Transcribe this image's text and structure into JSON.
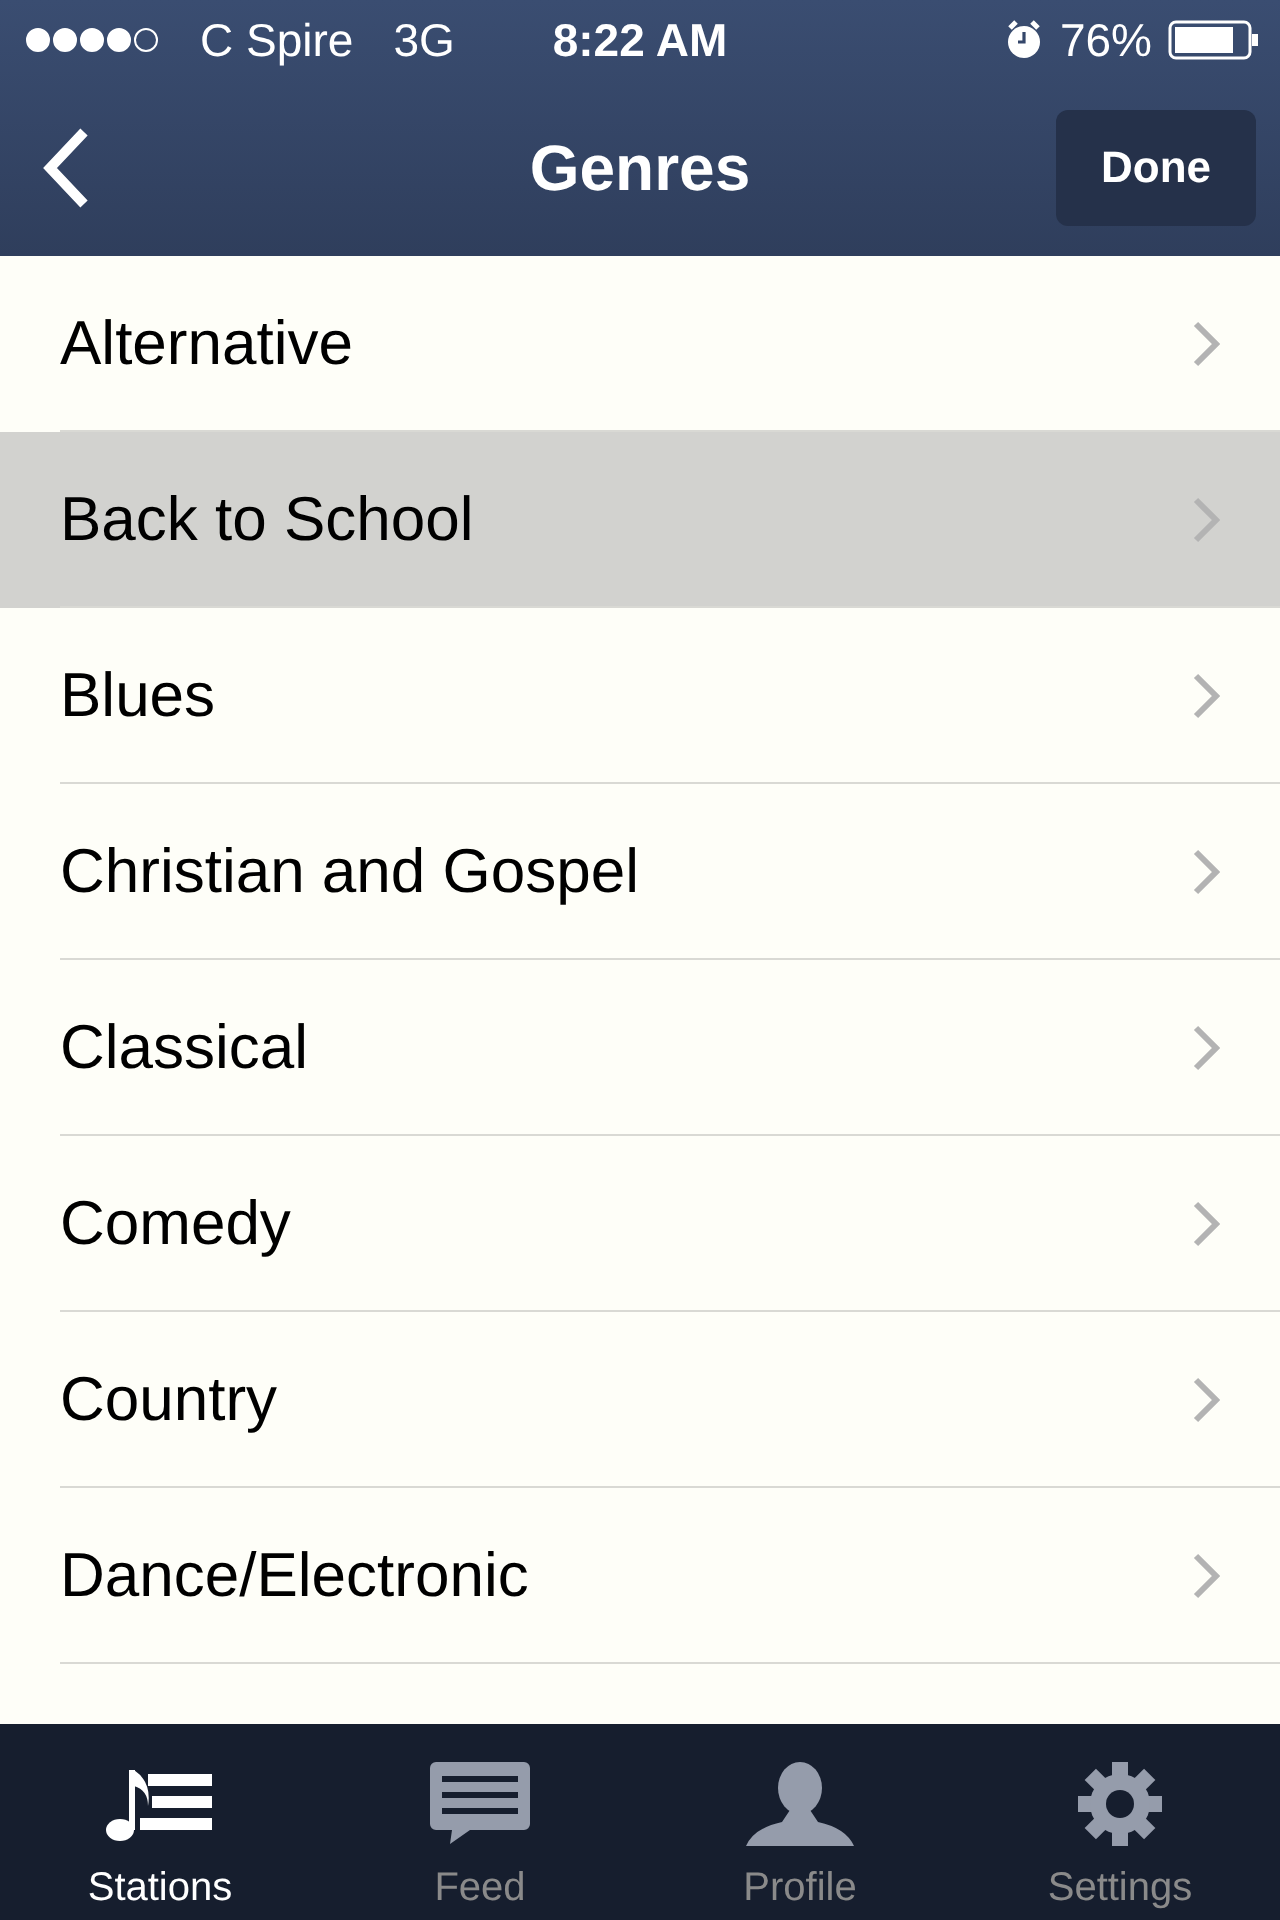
{
  "status_bar": {
    "carrier": "C Spire",
    "network": "3G",
    "time": "8:22 AM",
    "battery": "76%"
  },
  "nav_bar": {
    "title": "Genres",
    "done_button": "Done"
  },
  "genres": [
    {
      "label": "Alternative",
      "selected": false
    },
    {
      "label": "Back to School",
      "selected": true
    },
    {
      "label": "Blues",
      "selected": false
    },
    {
      "label": "Christian and Gospel",
      "selected": false
    },
    {
      "label": "Classical",
      "selected": false
    },
    {
      "label": "Comedy",
      "selected": false
    },
    {
      "label": "Country",
      "selected": false
    },
    {
      "label": "Dance/Electronic",
      "selected": false
    }
  ],
  "tab_bar": [
    {
      "label": "Stations",
      "kind": "stations",
      "selected": true
    },
    {
      "label": "Feed",
      "kind": "feed",
      "selected": false
    },
    {
      "label": "Profile",
      "kind": "profile",
      "selected": false
    },
    {
      "label": "Settings",
      "kind": "settings",
      "selected": false
    }
  ]
}
